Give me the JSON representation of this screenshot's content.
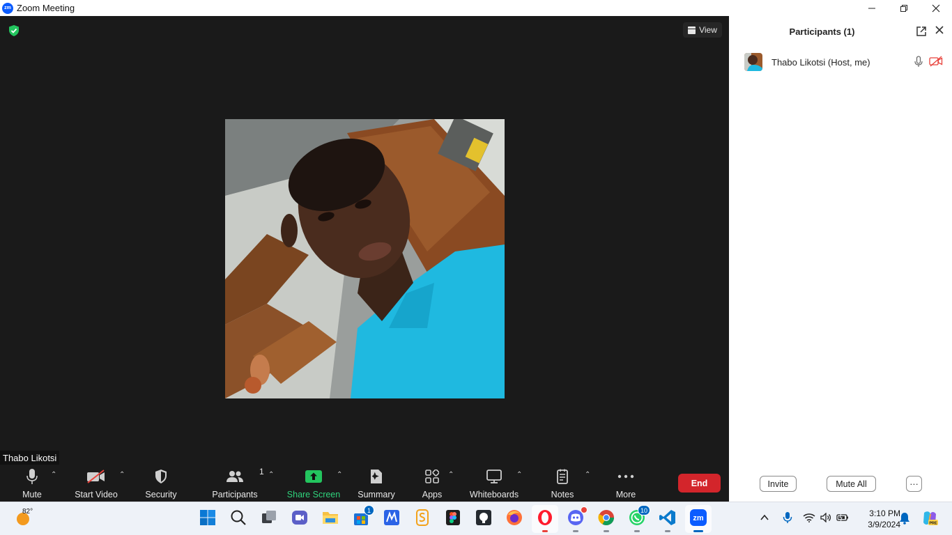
{
  "window": {
    "app_icon_text": "zm",
    "title": "Zoom Meeting"
  },
  "meeting": {
    "view_label": "View",
    "participant_name_label": "Thabo Likotsi"
  },
  "toolbar": {
    "mute": "Mute",
    "start_video": "Start Video",
    "security": "Security",
    "participants": "Participants",
    "participants_count": "1",
    "share_screen": "Share Screen",
    "summary": "Summary",
    "apps": "Apps",
    "whiteboards": "Whiteboards",
    "notes": "Notes",
    "more": "More",
    "end": "End"
  },
  "participants_panel": {
    "title": "Participants (1)",
    "participants": [
      {
        "name": "Thabo Likotsi (Host, me)",
        "mic": "unmuted",
        "video": "off"
      }
    ],
    "invite": "Invite",
    "mute_all": "Mute All",
    "more": "···"
  },
  "taskbar": {
    "weather_temp": "82°",
    "badges": {
      "store": "1",
      "whatsapp": "10"
    },
    "time": "3:10 PM",
    "date": "3/9/2024"
  },
  "colors": {
    "meeting_bg": "#1a1a1a",
    "end_button": "#d3252b",
    "share_screen_accent": "#2fd37c",
    "zoom_blue": "#0b5cff",
    "taskbar_bg": "#eef2f8"
  }
}
